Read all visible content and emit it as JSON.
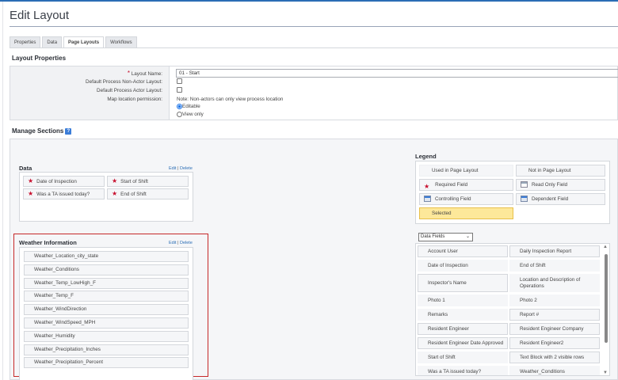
{
  "page": {
    "title": "Edit Layout"
  },
  "tabs": [
    {
      "label": "Properties"
    },
    {
      "label": "Data"
    },
    {
      "label": "Page Layouts",
      "active": true
    },
    {
      "label": "Workflows"
    }
  ],
  "layout_properties": {
    "heading": "Layout Properties",
    "layout_name_label": "Layout Name:",
    "layout_name_value": "01 - Start",
    "non_actor_label": "Default Process Non-Actor Layout:",
    "actor_label": "Default Process Actor Layout:",
    "map_label": "Map location permission:",
    "map_note": "Note: Non-actors can only view process location",
    "map_options": [
      {
        "label": "Editable",
        "selected": true
      },
      {
        "label": "View only",
        "selected": false
      }
    ]
  },
  "manage_sections": {
    "heading": "Manage Sections",
    "edit_label": "Edit",
    "delete_label": "Delete",
    "sections": [
      {
        "title": "Data",
        "fields": [
          "Date of Inspection",
          "Start of Shift",
          "Was a TA issued today?",
          "End of Shift"
        ]
      },
      {
        "title": "Weather Information",
        "fields": [
          "Weather_Location_city_state",
          "Weather_Conditions",
          "Weather_Temp_LowHigh_F",
          "Weather_Temp_F",
          "Weather_WindDirection",
          "Weather_WindSpeed_MPH",
          "Weather_Humidity",
          "Weather_Precipitation_Inches",
          "Weather_Precipitation_Percent"
        ]
      }
    ]
  },
  "legend": {
    "heading": "Legend",
    "items": [
      "Used in Page Layout",
      "Not in Page Layout",
      "Required Field",
      "Read Only Field",
      "Controlling Field",
      "Dependent Field",
      "Selected"
    ]
  },
  "data_fields": {
    "select_value": "Data Fields",
    "rows": [
      [
        "Account User",
        "Daily Inspection Report"
      ],
      [
        "Date of Inspection",
        "End of Shift"
      ],
      [
        "Inspector's Name",
        "Location and Description of Operations"
      ],
      [
        "Photo 1",
        "Photo 2"
      ],
      [
        "Remarks",
        "Report #"
      ],
      [
        "Resident Engineer",
        "Resident Engineer Company"
      ],
      [
        "Resident Engineer Date Approved",
        "Resident Engineer2"
      ],
      [
        "Start of Shift",
        "Text Block with 2 visible rows"
      ],
      [
        "Was a TA issued today?",
        "Weather_Conditions"
      ]
    ]
  },
  "colors": {
    "accent": "#2a6db5",
    "required": "#c8102e",
    "selected": "#fde89a",
    "highlight_border": "#c62828"
  }
}
